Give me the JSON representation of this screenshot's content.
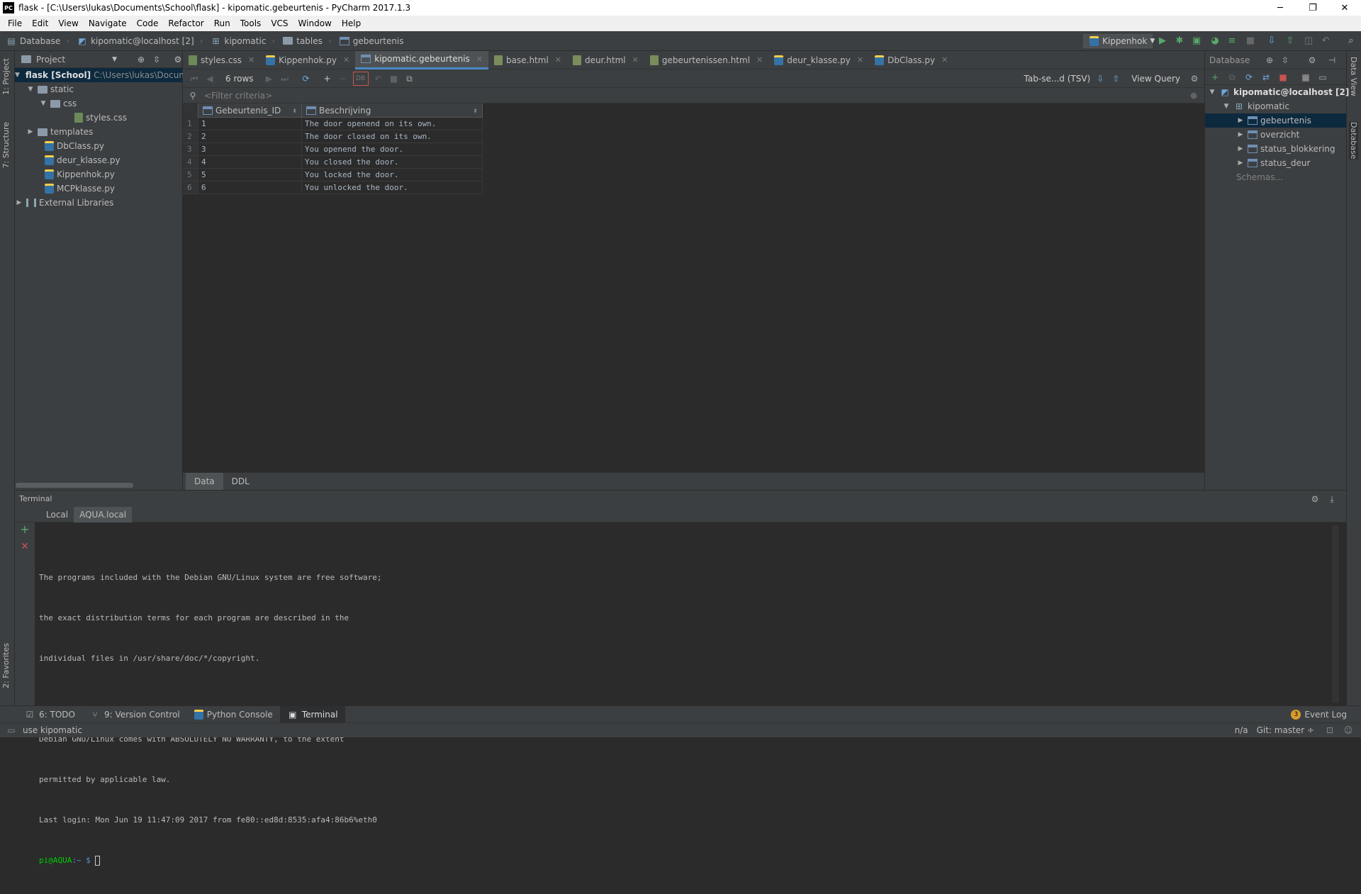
{
  "window": {
    "title": "flask - [C:\\Users\\lukas\\Documents\\School\\flask] - kipomatic.gebeurtenis - PyCharm 2017.1.3",
    "app_badge": "PC",
    "minimize_icon": "─",
    "restore_icon": "❐",
    "close_icon": "✕"
  },
  "menu": [
    "File",
    "Edit",
    "View",
    "Navigate",
    "Code",
    "Refactor",
    "Run",
    "Tools",
    "VCS",
    "Window",
    "Help"
  ],
  "breadcrumb": [
    "Database",
    "kipomatic@localhost [2]",
    "kipomatic",
    "tables",
    "gebeurtenis"
  ],
  "run_config": {
    "label": "Kippenhok"
  },
  "left_strip": {
    "project": "1: Project",
    "structure": "7: Structure",
    "favorites": "2: Favorites"
  },
  "right_strip": {
    "data_view": "Data View",
    "database": "Database"
  },
  "project_panel": {
    "title": "Project",
    "tree": [
      {
        "label": "flask [School]",
        "path": "C:\\Users\\lukas\\Docum"
      },
      {
        "label": "static"
      },
      {
        "label": "css"
      },
      {
        "label": "styles.css"
      },
      {
        "label": "templates"
      },
      {
        "label": "DbClass.py"
      },
      {
        "label": "deur_klasse.py"
      },
      {
        "label": "Kippenhok.py"
      },
      {
        "label": "MCPklasse.py"
      },
      {
        "label": "External Libraries"
      }
    ]
  },
  "tabs": [
    {
      "label": "styles.css"
    },
    {
      "label": "Kippenhok.py"
    },
    {
      "label": "kipomatic.gebeurtenis"
    },
    {
      "label": "base.html"
    },
    {
      "label": "deur.html"
    },
    {
      "label": "gebeurtenissen.html"
    },
    {
      "label": "deur_klasse.py"
    },
    {
      "label": "DbClass.py"
    }
  ],
  "grid_toolbar": {
    "rows": "6 rows",
    "export_format": "Tab-se...d (TSV)",
    "view_query": "View Query"
  },
  "filter": {
    "placeholder": "<Filter criteria>"
  },
  "table": {
    "columns": [
      "Gebeurtenis_ID",
      "Beschrijving"
    ],
    "rows": [
      {
        "n": "1",
        "id": "1",
        "desc": "The door openend on its own."
      },
      {
        "n": "2",
        "id": "2",
        "desc": "The door closed on its own."
      },
      {
        "n": "3",
        "id": "3",
        "desc": "You openend the door."
      },
      {
        "n": "4",
        "id": "4",
        "desc": "You closed the door."
      },
      {
        "n": "5",
        "id": "5",
        "desc": "You locked the door."
      },
      {
        "n": "6",
        "id": "6",
        "desc": "You unlocked the door."
      }
    ]
  },
  "editor_bottom_tabs": [
    "Data",
    "DDL"
  ],
  "database_panel": {
    "title": "Database",
    "tree": [
      {
        "label": "kipomatic@localhost [2]"
      },
      {
        "label": "kipomatic"
      },
      {
        "label": "gebeurtenis"
      },
      {
        "label": "overzicht"
      },
      {
        "label": "status_blokkering"
      },
      {
        "label": "status_deur"
      },
      {
        "label": "Schemas..."
      }
    ]
  },
  "terminal": {
    "title": "Terminal",
    "tabs": [
      "Local",
      "AQUA.local"
    ],
    "lines": [
      "The programs included with the Debian GNU/Linux system are free software;",
      "the exact distribution terms for each program are described in the",
      "individual files in /usr/share/doc/*/copyright.",
      "",
      "Debian GNU/Linux comes with ABSOLUTELY NO WARRANTY, to the extent",
      "permitted by applicable law.",
      "Last login: Mon Jun 19 11:47:09 2017 from fe80::ed8d:8535:afa4:86b6%eth0"
    ],
    "prompt_user": "pi@AQUA",
    "prompt_path": ":~ $",
    "prompt_color": "#00cd00"
  },
  "bottom_tools": [
    {
      "label": "6: TODO"
    },
    {
      "label": "9: Version Control"
    },
    {
      "label": "Python Console"
    },
    {
      "label": "Terminal"
    }
  ],
  "event_log": {
    "count": "3",
    "label": "Event Log"
  },
  "status": {
    "message": "use kipomatic",
    "position": "n/a",
    "git": "Git: master ÷"
  },
  "colors": {
    "accent": "#4a88c7",
    "selection": "#0d293e",
    "run_green": "#59a869",
    "stop_red": "#c75450"
  }
}
